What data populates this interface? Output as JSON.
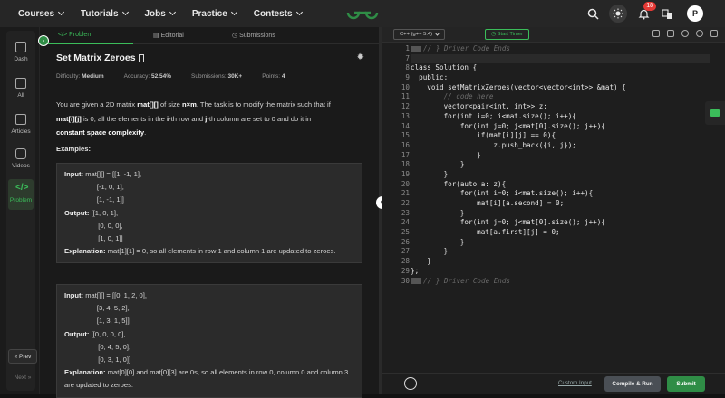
{
  "topnav": {
    "items": [
      {
        "label": "Courses"
      },
      {
        "label": "Tutorials"
      },
      {
        "label": "Jobs"
      },
      {
        "label": "Practice"
      },
      {
        "label": "Contests"
      }
    ],
    "notification_count": "18",
    "avatar_initial": "P"
  },
  "sidebar": {
    "items": [
      {
        "label": "Dash"
      },
      {
        "label": "All"
      },
      {
        "label": "Articles"
      },
      {
        "label": "Videos"
      },
      {
        "label": "Problem"
      }
    ],
    "prev_label": "« Prev",
    "next_label": "Next »"
  },
  "tabs": {
    "problem": "Problem",
    "editorial": "Editorial",
    "submissions": "Submissions"
  },
  "problem": {
    "title": "Set Matrix Zeroes",
    "difficulty_label": "Difficulty:",
    "difficulty": "Medium",
    "accuracy_label": "Accuracy:",
    "accuracy": "52.54%",
    "submissions_label": "Submissions:",
    "submissions": "30K+",
    "points_label": "Points:",
    "points": "4",
    "examples_heading": "Examples:"
  },
  "examples": [
    {
      "input_label": "Input:",
      "input_lines": [
        "mat[][] = [[1, -1, 1],",
        "                 [-1, 0, 1],",
        "                 [1, -1, 1]]"
      ],
      "output_label": "Output:",
      "output_lines": [
        "[[1, 0, 1],",
        "  [0, 0, 0],",
        "  [1, 0, 1]]"
      ],
      "explanation_label": "Explanation:",
      "explanation": "mat[1][1] = 0, so all elements in row 1 and column 1 are updated to zeroes."
    },
    {
      "input_label": "Input:",
      "input_lines": [
        "mat[][] = [[0, 1, 2, 0],",
        "                 [3, 4, 5, 2],",
        "                 [1, 3, 1, 5]]"
      ],
      "output_label": "Output:",
      "output_lines": [
        "[[0, 0, 0, 0],",
        "  [0, 4, 5, 0],",
        "  [0, 3, 1, 0]]"
      ],
      "explanation_label": "Explanation:",
      "explanation": "mat[0][0] and mat[0][3] are 0s, so all elements in row 0, column 0 and column 3 are updated to zeroes."
    }
  ],
  "editor": {
    "language": "C++ (g++ 5.4)",
    "timer_label": "Start Timer",
    "line_numbers": [
      "1",
      "7",
      "8",
      "9",
      "10",
      "11",
      "12",
      "13",
      "14",
      "15",
      "16",
      "17",
      "18",
      "19",
      "20",
      "21",
      "22",
      "23",
      "24",
      "25",
      "26",
      "27",
      "28",
      "29",
      "30"
    ],
    "code_lines": [
      "// } Driver Code Ends",
      "",
      "class Solution {",
      "  public:",
      "    void setMatrixZeroes(vector<vector<int>> &mat) {",
      "        // code here",
      "        vector<pair<int, int>> z;",
      "        for(int i=0; i<mat.size(); i++){",
      "            for(int j=0; j<mat[0].size(); j++){",
      "                if(mat[i][j] == 0){",
      "                    z.push_back({i, j});",
      "                }",
      "            }",
      "        }",
      "        for(auto a: z){",
      "            for(int i=0; i<mat.size(); i++){",
      "                mat[i][a.second] = 0;",
      "            }",
      "            for(int j=0; j<mat[0].size(); j++){",
      "                mat[a.first][j] = 0;",
      "            }",
      "        }",
      "    }",
      "};",
      "// } Driver Code Ends"
    ],
    "custom_input_label": "Custom Input",
    "compile_run_label": "Compile & Run",
    "submit_label": "Submit"
  },
  "colors": {
    "accent": "#3bbd5a",
    "brand": "#2f8d46",
    "background": "#121212"
  }
}
